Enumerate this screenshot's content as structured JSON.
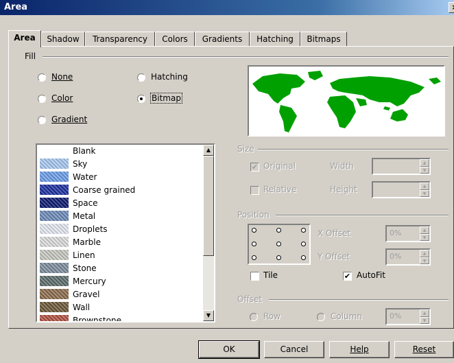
{
  "window": {
    "title": "Area",
    "close_glyph": "×"
  },
  "tabs": [
    "Area",
    "Shadow",
    "Transparency",
    "Colors",
    "Gradients",
    "Hatching",
    "Bitmaps"
  ],
  "fill": {
    "label": "Fill",
    "options": {
      "none": "None",
      "color": "Color",
      "gradient": "Gradient",
      "hatching": "Hatching",
      "bitmap": "Bitmap"
    },
    "selected": "Bitmap"
  },
  "bitmaps": [
    {
      "name": "Blank",
      "color": "#ffffff"
    },
    {
      "name": "Sky",
      "color": "#a8c8f0"
    },
    {
      "name": "Water",
      "color": "#6c9ee8"
    },
    {
      "name": "Coarse grained",
      "color": "#1c2fa0"
    },
    {
      "name": "Space",
      "color": "#0c1870"
    },
    {
      "name": "Metal",
      "color": "#6c8ab8"
    },
    {
      "name": "Droplets",
      "color": "#e4e8f0"
    },
    {
      "name": "Marble",
      "color": "#dcdcdc"
    },
    {
      "name": "Linen",
      "color": "#c8c8c0"
    },
    {
      "name": "Stone",
      "color": "#7c8c9c"
    },
    {
      "name": "Mercury",
      "color": "#5c6c6c"
    },
    {
      "name": "Gravel",
      "color": "#8c6c4c"
    },
    {
      "name": "Wall",
      "color": "#6c5838"
    },
    {
      "name": "Brownstone",
      "color": "#b05040"
    }
  ],
  "size": {
    "label": "Size",
    "original": "Original",
    "original_checked": true,
    "relative": "Relative",
    "relative_checked": false,
    "width_label": "Width",
    "height_label": "Height"
  },
  "position": {
    "label": "Position",
    "x_offset_label": "X Offset",
    "x_offset_value": "0%",
    "y_offset_label": "Y Offset",
    "y_offset_value": "0%",
    "tile": "Tile",
    "tile_checked": false,
    "autofit": "AutoFit",
    "autofit_checked": true
  },
  "offset": {
    "label": "Offset",
    "row": "Row",
    "column": "Column",
    "value": "0%"
  },
  "buttons": {
    "ok": "OK",
    "cancel": "Cancel",
    "help": "Help",
    "reset": "Reset"
  },
  "colors": {
    "title_start": "#0a246a",
    "dialog_bg": "#d4d0c8",
    "map_land": "#00a000"
  }
}
